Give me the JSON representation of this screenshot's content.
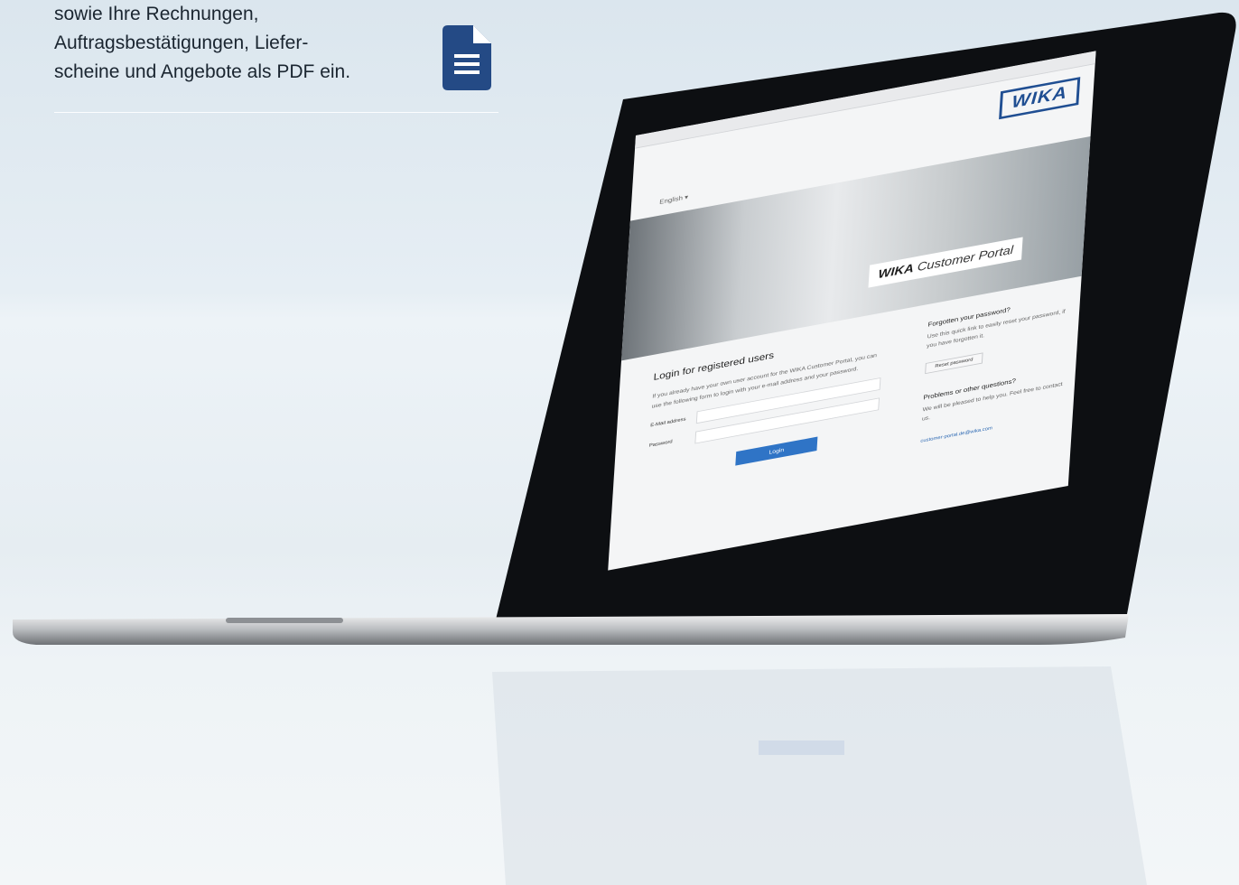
{
  "intro": {
    "line1": "sowie Ihre Rechnungen,",
    "line2": "Auftragsbestätigungen, Liefer-",
    "line3": "scheine und Angebote als PDF ein."
  },
  "icons": {
    "document": "document-icon"
  },
  "portal": {
    "language": "English ▾",
    "logo": "WIKA",
    "banner_title_bold": "WIKA",
    "banner_title_rest": " Customer Portal",
    "login": {
      "heading": "Login for registered users",
      "description": "If you already have your own user account for the WIKA Customer Portal, you can use the following form to login with your e-mail address and your password.",
      "email_label": "E-Mail address",
      "password_label": "Password",
      "button": "Login"
    },
    "forgot": {
      "heading": "Forgotten your password?",
      "text": "Use this quick link to easily reset your password, if you have forgotten it.",
      "button": "Reset password"
    },
    "help": {
      "heading": "Problems or other questions?",
      "text": "We will be pleased to help you. Feel free to contact us.",
      "email": "customer-portal.de@wika.com"
    }
  },
  "colors": {
    "brand_blue": "#1f4e92",
    "button_blue": "#2f74c6",
    "icon_blue": "#244a85"
  }
}
